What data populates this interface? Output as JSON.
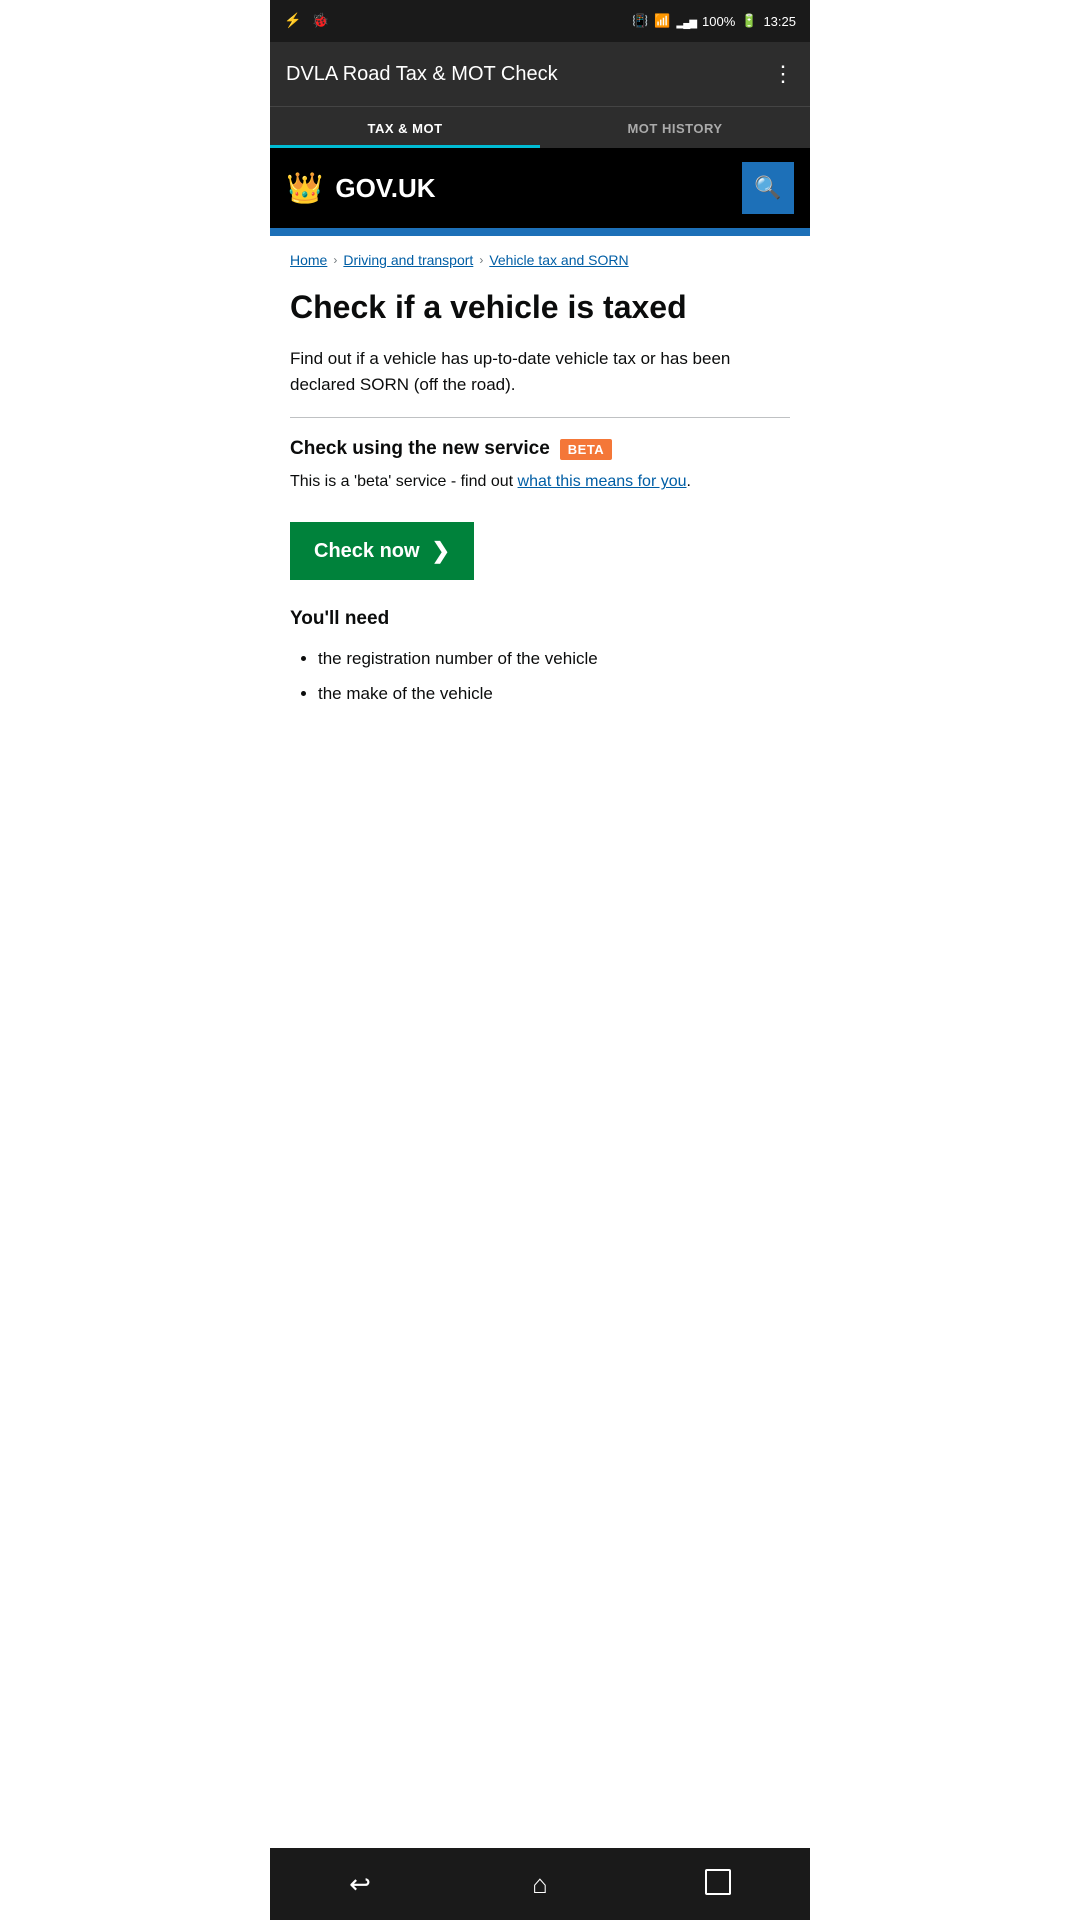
{
  "statusBar": {
    "battery": "100%",
    "time": "13:25"
  },
  "appBar": {
    "title": "DVLA Road Tax & MOT Check",
    "moreIcon": "⋮"
  },
  "tabs": [
    {
      "label": "TAX & MOT",
      "active": true
    },
    {
      "label": "MOT HISTORY",
      "active": false
    }
  ],
  "govuk": {
    "logoText": "GOV.UK",
    "searchIconLabel": "🔍"
  },
  "breadcrumb": {
    "home": "Home",
    "driving": "Driving and transport",
    "vehicle": "Vehicle tax and SORN"
  },
  "page": {
    "title": "Check if a vehicle is taxed",
    "description": "Find out if a vehicle has up-to-date vehicle tax or has been declared SORN (off the road).",
    "betaHeading": "Check using the new service",
    "betaBadge": "BETA",
    "betaText": "This is a 'beta' service - find out ",
    "betaLink": "what this means for you",
    "betaLinkPunctuation": ".",
    "checkNowLabel": "Check now",
    "youllNeedTitle": "You'll need",
    "youllNeedItems": [
      "the registration number of the vehicle",
      "the make of the vehicle"
    ]
  },
  "bottomNav": {
    "back": "back",
    "home": "home",
    "recents": "recents"
  }
}
